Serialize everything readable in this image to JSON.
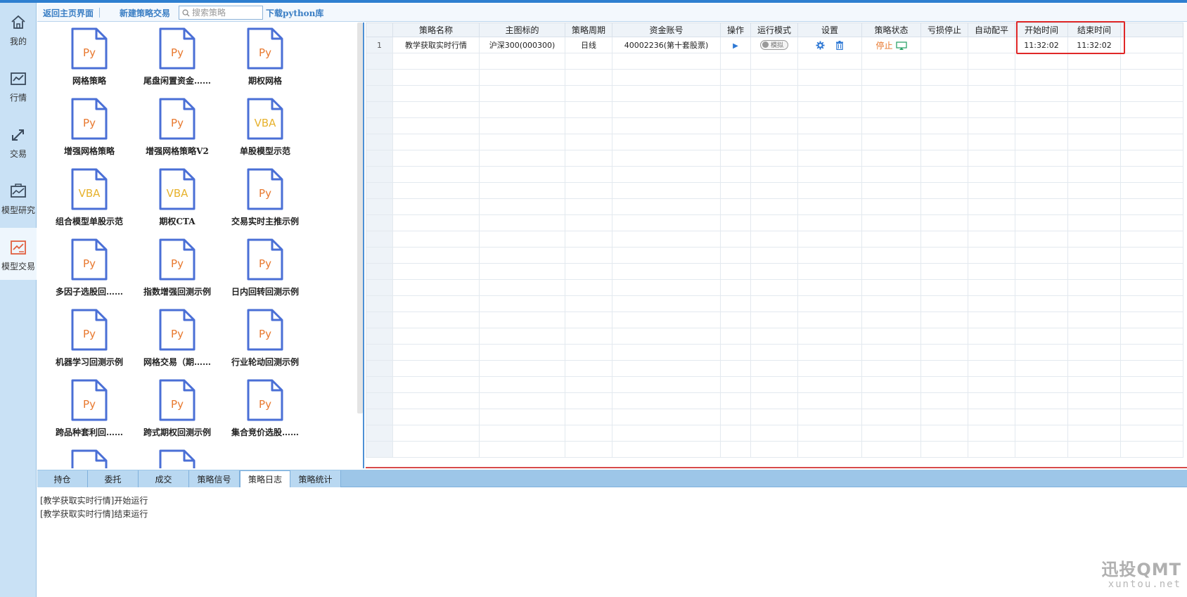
{
  "sidebar": {
    "items": [
      {
        "label": "我的",
        "icon": "home-icon"
      },
      {
        "label": "行情",
        "icon": "chart-line-icon"
      },
      {
        "label": "交易",
        "icon": "transfer-arrows-icon"
      },
      {
        "label": "模型研究",
        "icon": "model-research-icon"
      },
      {
        "label": "模型交易",
        "icon": "model-trading-icon",
        "active": true
      }
    ]
  },
  "toolbar": {
    "back_label": "返回主页界面",
    "new_label": "新建策略交易",
    "search_placeholder": "搜索策略",
    "download_label": "下载python库"
  },
  "strategies": [
    {
      "name": "网格策略",
      "type": "Py"
    },
    {
      "name": "尾盘闲置资金……",
      "type": "Py"
    },
    {
      "name": "期权网格",
      "type": "Py"
    },
    {
      "name": "增强网格策略",
      "type": "Py"
    },
    {
      "name": "增强网格策略V2",
      "type": "Py"
    },
    {
      "name": "单股模型示范",
      "type": "VBA"
    },
    {
      "name": "组合模型单股示范",
      "type": "VBA"
    },
    {
      "name": "期权CTA",
      "type": "VBA"
    },
    {
      "name": "交易实时主推示例",
      "type": "Py"
    },
    {
      "name": "多因子选股回……",
      "type": "Py"
    },
    {
      "name": "指数增强回测示例",
      "type": "Py"
    },
    {
      "name": "日内回转回测示例",
      "type": "Py"
    },
    {
      "name": "机器学习回测示例",
      "type": "Py"
    },
    {
      "name": "网格交易（期……",
      "type": "Py"
    },
    {
      "name": "行业轮动回测示例",
      "type": "Py"
    },
    {
      "name": "跨品种套利回……",
      "type": "Py"
    },
    {
      "name": "跨式期权回测示例",
      "type": "Py"
    },
    {
      "name": "集合竞价选股……",
      "type": "Py"
    },
    {
      "name": "",
      "type": ""
    },
    {
      "name": "",
      "type": ""
    }
  ],
  "table": {
    "headers": [
      "策略名称",
      "主图标的",
      "策略周期",
      "资金账号",
      "操作",
      "运行模式",
      "设置",
      "策略状态",
      "亏损停止",
      "自动配平",
      "开始时间",
      "结束时间"
    ],
    "rows": [
      {
        "index": "1",
        "name": "教学获取实时行情",
        "symbol": "沪深300(000300)",
        "period": "日线",
        "account": "40002236(第十套股票)",
        "mode": "模拟",
        "status": "停止",
        "loss_stop": "",
        "auto_balance": "",
        "start_time": "11:32:02",
        "end_time": "11:32:02"
      }
    ]
  },
  "bottom_tabs": [
    {
      "label": "持仓"
    },
    {
      "label": "委托"
    },
    {
      "label": "成交"
    },
    {
      "label": "策略信号"
    },
    {
      "label": "策略日志",
      "active": true
    },
    {
      "label": "策略统计"
    }
  ],
  "log": [
    "[教学获取实时行情]开始运行",
    "[教学获取实时行情]结束运行"
  ],
  "watermark": {
    "title": "迅投QMT",
    "url": "xuntou.net"
  },
  "colors": {
    "accent": "#2e7fd0",
    "py": "#e8782e",
    "vba": "#e7b22d",
    "icon_border": "#4a6fd6",
    "highlight": "#e02727"
  }
}
